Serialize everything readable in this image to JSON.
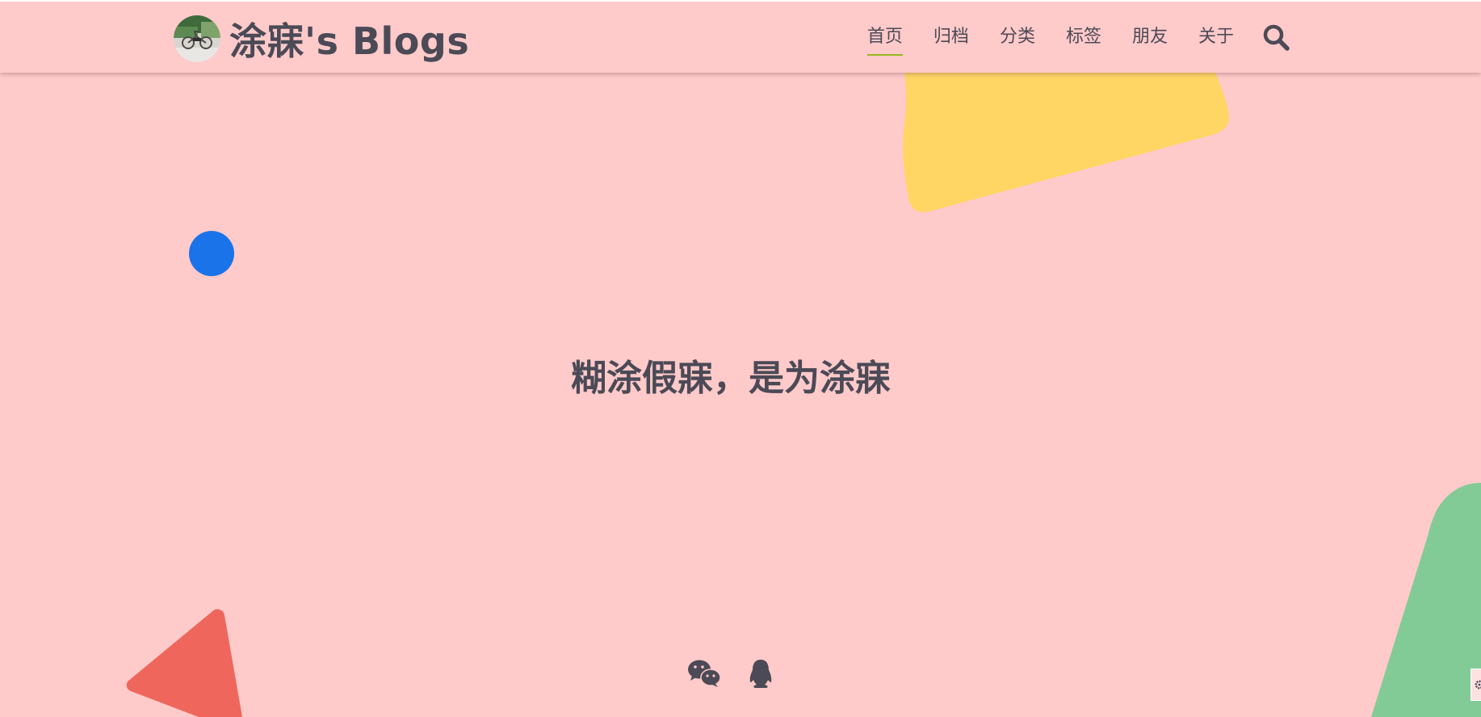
{
  "header": {
    "avatar_icon": "avatar-photo-bicycle",
    "brand_title": "涂寐's Blogs",
    "nav": [
      {
        "label": "首页",
        "active": true
      },
      {
        "label": "归档",
        "active": false
      },
      {
        "label": "分类",
        "active": false
      },
      {
        "label": "标签",
        "active": false
      },
      {
        "label": "朋友",
        "active": false
      },
      {
        "label": "关于",
        "active": false
      }
    ],
    "search_icon": "search-icon"
  },
  "hero": {
    "slogan": "糊涂假寐，是为涂寐"
  },
  "social": [
    {
      "icon": "wechat-icon"
    },
    {
      "icon": "qq-icon"
    }
  ],
  "edge_widget_icon": "gear-icon",
  "colors": {
    "background": "#ffcaca",
    "text": "#4b4a56",
    "nav_active_underline": "#95b81e",
    "shape_yellow": "#ffd664",
    "shape_blue": "#1a73e8",
    "shape_red": "#ef675c",
    "shape_green": "#83cb96"
  }
}
